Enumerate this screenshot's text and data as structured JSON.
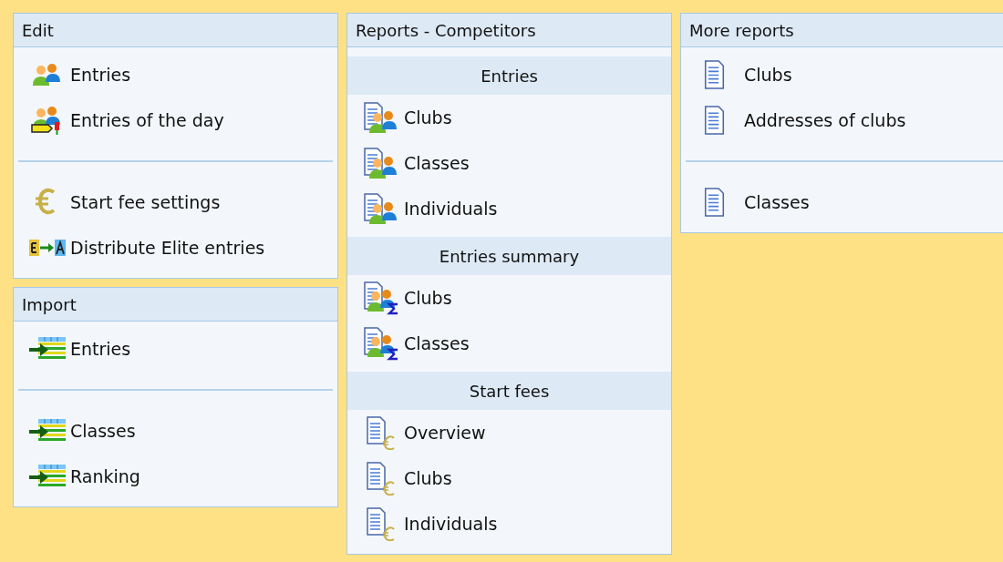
{
  "panels": [
    {
      "title": "Edit",
      "items": [
        {
          "kind": "people",
          "label": "Entries"
        },
        {
          "kind": "people-tag",
          "label": "Entries of the day"
        },
        {
          "kind": "separator"
        },
        {
          "kind": "euro",
          "label": "Start fee settings"
        },
        {
          "kind": "transfer",
          "label": "Distribute Elite entries"
        }
      ]
    },
    {
      "title": "Import",
      "items": [
        {
          "kind": "import",
          "label": "Entries"
        },
        {
          "kind": "separator"
        },
        {
          "kind": "import",
          "label": "Classes"
        },
        {
          "kind": "import",
          "label": "Ranking"
        }
      ]
    },
    {
      "title": "Reports - Competitors",
      "items": [
        {
          "kind": "section",
          "label": "Entries"
        },
        {
          "kind": "report-people",
          "label": "Clubs"
        },
        {
          "kind": "report-people",
          "label": "Classes"
        },
        {
          "kind": "report-people",
          "label": "Individuals"
        },
        {
          "kind": "section",
          "label": "Entries summary"
        },
        {
          "kind": "report-sum",
          "label": "Clubs"
        },
        {
          "kind": "report-sum",
          "label": "Classes"
        },
        {
          "kind": "section",
          "label": "Start fees"
        },
        {
          "kind": "report-euro",
          "label": "Overview"
        },
        {
          "kind": "report-euro",
          "label": "Clubs"
        },
        {
          "kind": "report-euro",
          "label": "Individuals"
        }
      ]
    },
    {
      "title": "More reports",
      "items": [
        {
          "kind": "report",
          "label": "Clubs"
        },
        {
          "kind": "report",
          "label": "Addresses of clubs"
        },
        {
          "kind": "separator"
        },
        {
          "kind": "report",
          "label": "Classes"
        }
      ]
    }
  ]
}
